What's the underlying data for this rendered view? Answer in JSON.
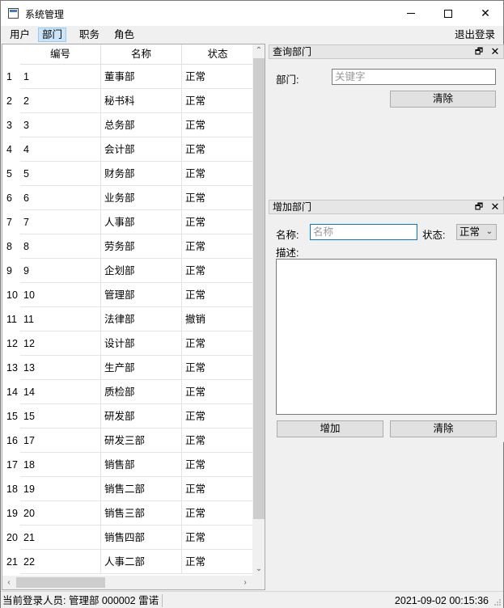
{
  "window": {
    "title": "系统管理"
  },
  "menu": {
    "items": [
      "用户",
      "部门",
      "职务",
      "角色"
    ],
    "active": "部门",
    "logout": "退出登录"
  },
  "table": {
    "columns": [
      "编号",
      "名称",
      "状态"
    ],
    "rows": [
      {
        "num": "1",
        "id": "1",
        "name": "董事部",
        "status": "正常"
      },
      {
        "num": "2",
        "id": "2",
        "name": "秘书科",
        "status": "正常"
      },
      {
        "num": "3",
        "id": "3",
        "name": "总务部",
        "status": "正常"
      },
      {
        "num": "4",
        "id": "4",
        "name": "会计部",
        "status": "正常"
      },
      {
        "num": "5",
        "id": "5",
        "name": "财务部",
        "status": "正常"
      },
      {
        "num": "6",
        "id": "6",
        "name": "业务部",
        "status": "正常"
      },
      {
        "num": "7",
        "id": "7",
        "name": "人事部",
        "status": "正常"
      },
      {
        "num": "8",
        "id": "8",
        "name": "劳务部",
        "status": "正常"
      },
      {
        "num": "9",
        "id": "9",
        "name": "企划部",
        "status": "正常"
      },
      {
        "num": "10",
        "id": "10",
        "name": "管理部",
        "status": "正常"
      },
      {
        "num": "11",
        "id": "11",
        "name": "法律部",
        "status": "撤销"
      },
      {
        "num": "12",
        "id": "12",
        "name": "设计部",
        "status": "正常"
      },
      {
        "num": "13",
        "id": "13",
        "name": "生产部",
        "status": "正常"
      },
      {
        "num": "14",
        "id": "14",
        "name": "质检部",
        "status": "正常"
      },
      {
        "num": "15",
        "id": "15",
        "name": "研发部",
        "status": "正常"
      },
      {
        "num": "16",
        "id": "17",
        "name": "研发三部",
        "status": "正常"
      },
      {
        "num": "17",
        "id": "18",
        "name": "销售部",
        "status": "正常"
      },
      {
        "num": "18",
        "id": "19",
        "name": "销售二部",
        "status": "正常"
      },
      {
        "num": "19",
        "id": "20",
        "name": "销售三部",
        "status": "正常"
      },
      {
        "num": "20",
        "id": "21",
        "name": "销售四部",
        "status": "正常"
      },
      {
        "num": "21",
        "id": "22",
        "name": "人事二部",
        "status": "正常"
      }
    ]
  },
  "query_panel": {
    "title": "查询部门",
    "dept_label": "部门:",
    "keyword_placeholder": "关键字",
    "clear_label": "清除"
  },
  "add_panel": {
    "title": "增加部门",
    "name_label": "名称:",
    "name_placeholder": "名称",
    "status_label": "状态:",
    "status_value": "正常",
    "desc_label": "描述:",
    "add_label": "增加",
    "clear_label": "清除"
  },
  "status_bar": {
    "login_info": "当前登录人员: 管理部 000002 雷诺",
    "datetime": "2021-09-02 00:15:36"
  },
  "colors": {
    "accent": "#0078d7",
    "active_menu": "#cce4f7"
  }
}
